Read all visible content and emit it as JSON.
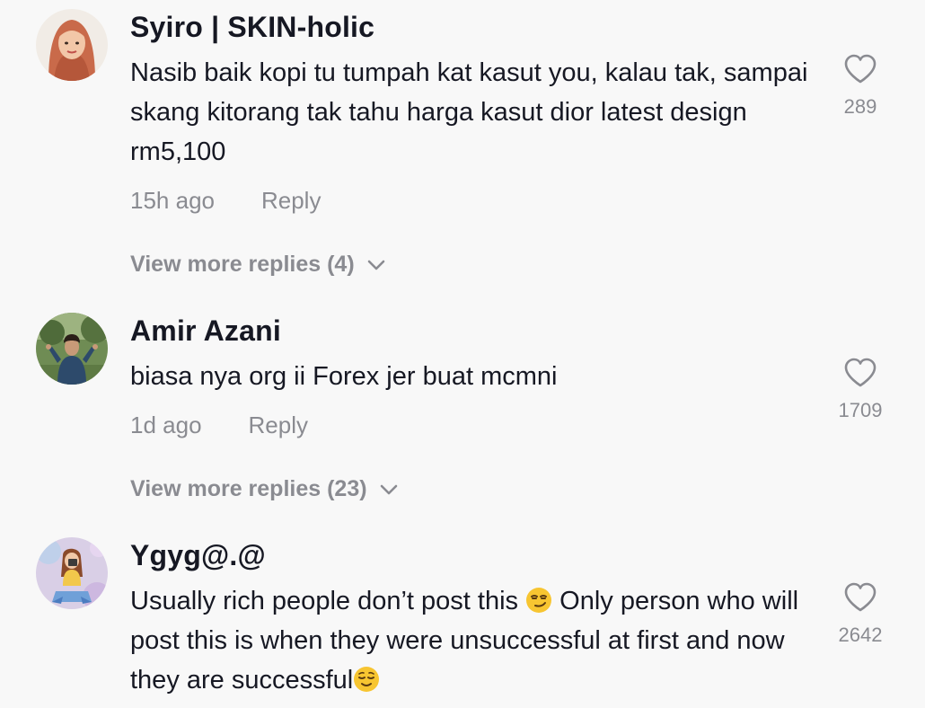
{
  "comments": [
    {
      "username": "Syiro | SKIN-holic",
      "text": "Nasib baik kopi tu tumpah kat kasut you, kalau tak, sampai skang kitorang tak tahu harga kasut dior latest design rm5,100",
      "time": "15h ago",
      "reply_label": "Reply",
      "view_more": "View more replies (4)",
      "likes": "289",
      "avatar_icon": "avatar-woman-hijab"
    },
    {
      "username": "Amir Azani",
      "text": "biasa nya org ii Forex jer buat mcmni",
      "time": "1d ago",
      "reply_label": "Reply",
      "view_more": "View more replies (23)",
      "likes": "1709",
      "avatar_icon": "avatar-man-outdoors"
    },
    {
      "username": "Ygyg@.@",
      "text_part1": "Usually rich people don’t post this ",
      "text_emoji1": "smirking-face",
      "text_part2": " Only person who will post this is when they were unsuccessful at first and now they are successful",
      "text_emoji2": "relieved-face",
      "likes": "2642",
      "avatar_icon": "avatar-illustrated-girl"
    }
  ],
  "colors": {
    "background": "#f8f8f8",
    "text_primary": "#161823",
    "text_secondary": "#8a8b91"
  }
}
